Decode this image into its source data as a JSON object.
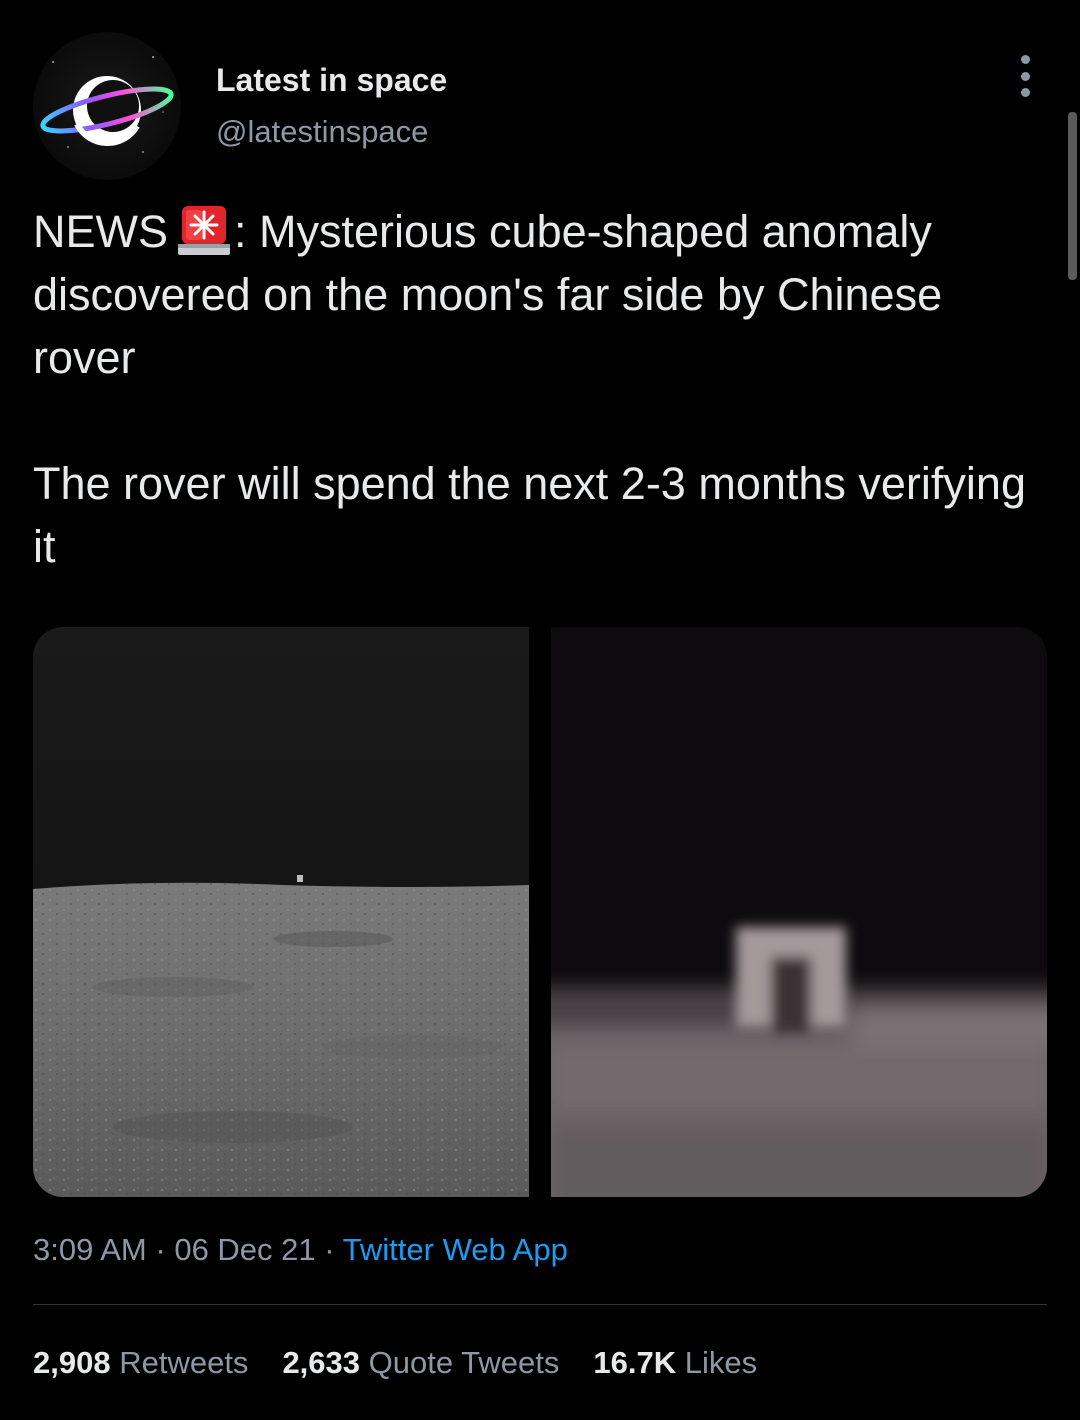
{
  "tweet": {
    "author": {
      "display_name": "Latest in space",
      "handle": "@latestinspace"
    },
    "text_line_1_before_icon": "NEWS",
    "icon": "police-car-light-siren-icon",
    "text_line_1_after_icon": ": Mysterious cube-shaped anomaly discovered on the moon's far side by Chinese rover",
    "text_paragraph_2": "The rover will spend the next 2-3 months verifying it",
    "meta": {
      "time": "3:09 AM",
      "separator": "·",
      "date": "06 Dec 21",
      "source": "Twitter Web App"
    },
    "stats": {
      "retweets_count": "2,908",
      "retweets_label": "Retweets",
      "quote_tweets_count": "2,633",
      "quote_tweets_label": "Quote Tweets",
      "likes_count": "16.7K",
      "likes_label": "Likes"
    }
  },
  "colors": {
    "background": "#000000",
    "primary_text": "#e7e9ea",
    "secondary_text": "#8b98a5",
    "link": "#1d9bf0",
    "divider": "#2f3336"
  }
}
